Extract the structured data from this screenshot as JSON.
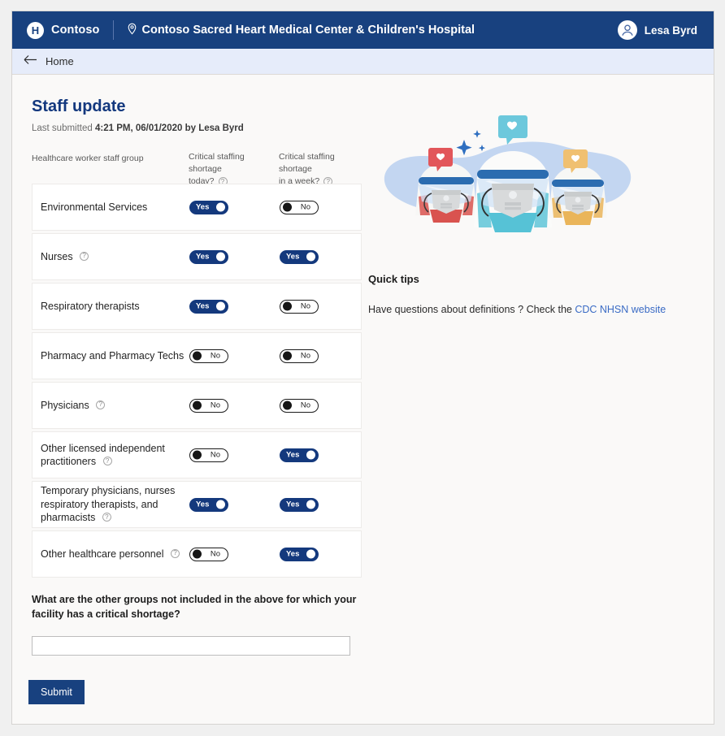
{
  "topnav": {
    "logo_glyph": "H",
    "brand": "Contoso",
    "facility": "Contoso Sacred Heart Medical Center & Children's Hospital",
    "user_name": "Lesa Byrd",
    "brand_color": "#18417f"
  },
  "homebar": {
    "label": "Home"
  },
  "main": {
    "title": "Staff update",
    "last_submitted_prefix": "Last submitted ",
    "last_submitted_value": "4:21 PM, 06/01/2020 by Lesa Byrd",
    "columns": {
      "group": "Healthcare worker staff group",
      "today_line1": "Critical staffing shortage",
      "today_line2": "today?",
      "week_line1": "Critical staffing shortage",
      "week_line2": "in a week?"
    },
    "toggle_labels": {
      "yes": "Yes",
      "no": "No"
    },
    "rows": [
      {
        "label": "Environmental Services",
        "has_info": false,
        "today": "Yes",
        "week": "No"
      },
      {
        "label": "Nurses",
        "has_info": true,
        "today": "Yes",
        "week": "Yes"
      },
      {
        "label": "Respiratory therapists",
        "has_info": false,
        "today": "Yes",
        "week": "No"
      },
      {
        "label": "Pharmacy and Pharmacy Techs",
        "has_info": false,
        "today": "No",
        "week": "No"
      },
      {
        "label": "Physicians",
        "has_info": true,
        "today": "No",
        "week": "No"
      },
      {
        "label": "Other licensed independent practitioners",
        "has_info": true,
        "today": "No",
        "week": "Yes"
      },
      {
        "label": "Temporary physicians, nurses respiratory therapists, and pharmacists",
        "has_info": true,
        "today": "Yes",
        "week": "Yes"
      },
      {
        "label": "Other healthcare personnel",
        "has_info": true,
        "today": "No",
        "week": "Yes"
      }
    ],
    "other_question": "What are the other groups not included in the above for which your facility has a critical shortage?",
    "other_value": "",
    "other_placeholder": "",
    "submit_label": "Submit"
  },
  "tips": {
    "title": "Quick tips",
    "text_before": "Have questions about definitions ? Check the ",
    "link_text": "CDC NHSN website",
    "link_color": "#3a6bc5"
  },
  "icons": {
    "info": "?",
    "location_pin": "location-pin-icon",
    "back_arrow": "arrow-left-icon",
    "avatar": "person-icon"
  }
}
